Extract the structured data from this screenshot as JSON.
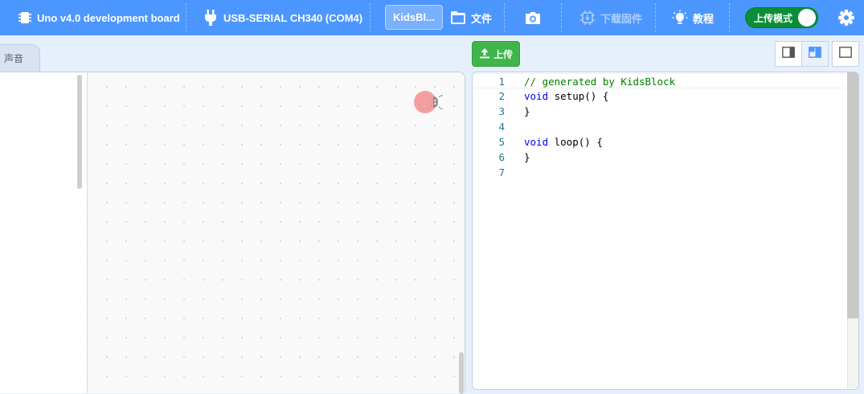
{
  "topbar": {
    "board_label": "Uno v4.0 development board",
    "port_label": "USB-SERIAL CH340 (COM4)",
    "project_name": "KidsBl...",
    "file_label": "文件",
    "firmware_label": "下载固件",
    "tutorial_label": "教程",
    "mode_label": "上传模式",
    "mode_on": true
  },
  "tabs": {
    "sound_label": "声音"
  },
  "toolbar": {
    "upload_label": "上传"
  },
  "editor": {
    "lines": [
      {
        "num": "1",
        "comment": "// generated by KidsBlock"
      },
      {
        "num": "2",
        "kw": "void",
        "rest": " setup() {"
      },
      {
        "num": "3",
        "rest": "}"
      },
      {
        "num": "4",
        "rest": ""
      },
      {
        "num": "5",
        "kw": "void",
        "rest": " loop() {"
      },
      {
        "num": "6",
        "rest": "}"
      },
      {
        "num": "7",
        "rest": ""
      }
    ]
  },
  "colors": {
    "topbar": "#4c97ff",
    "upload_button": "#3fb54a",
    "mode_toggle": "#0b8e36",
    "keyword": "#0000ff",
    "comment": "#008000",
    "line_number": "#237893"
  },
  "icons": {
    "board": "chip-icon",
    "port": "plug-icon",
    "file": "folder-icon",
    "camera": "camera-icon",
    "firmware": "chip-download-icon",
    "tutorial": "lightbulb-icon",
    "settings": "gear-icon",
    "upload": "upload-icon",
    "sprite": "ladybug-icon"
  }
}
